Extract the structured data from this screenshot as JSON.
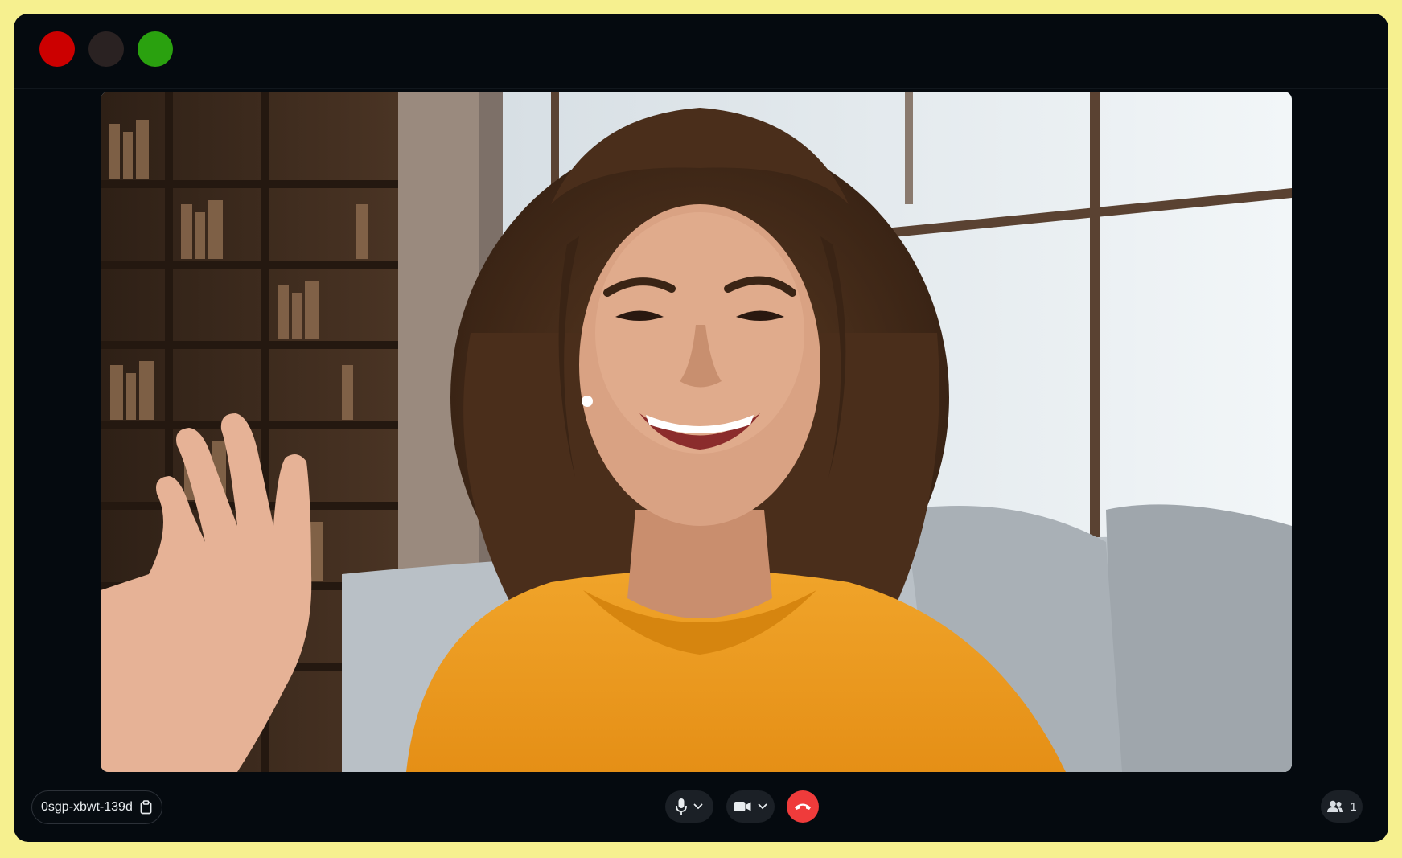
{
  "window": {
    "controls": [
      "close",
      "minimize",
      "maximize"
    ],
    "colors": {
      "close": "#cc0000",
      "minimize": "#2a2222",
      "maximize": "#2aa10f",
      "frame_background": "#050a0f",
      "outer_background": "#f6f08f",
      "hangup": "#ef3b3b"
    }
  },
  "video": {
    "icon": "video-feed"
  },
  "controls": {
    "meeting_code": "0sgp-xbwt-139d",
    "copy_icon": "clipboard-icon",
    "mic_icon": "microphone-icon",
    "camera_icon": "video-camera-icon",
    "hangup_icon": "phone-hangup-icon",
    "participants_icon": "people-icon",
    "participants_count": "1"
  }
}
